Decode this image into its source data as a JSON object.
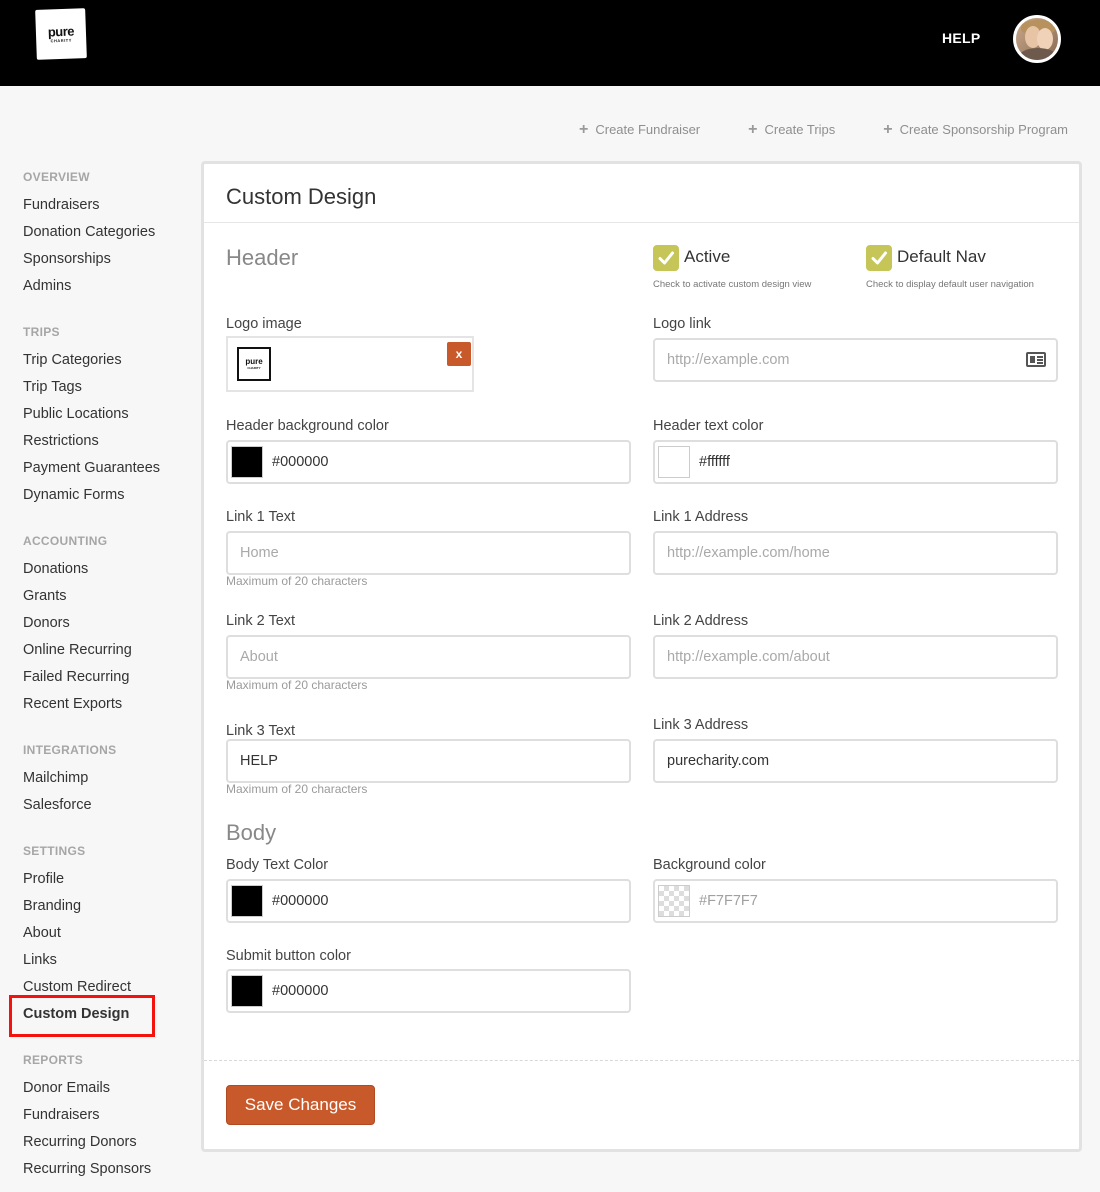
{
  "brand": {
    "logo_line1": "pure",
    "logo_line2": "CHARITY"
  },
  "topbar": {
    "help_link": "HELP"
  },
  "quick_actions": [
    {
      "icon": "plus-icon",
      "label": "Create Fundraiser"
    },
    {
      "icon": "plus-icon",
      "label": "Create Trips"
    },
    {
      "icon": "plus-icon",
      "label": "Create Sponsorship Program"
    }
  ],
  "sidebar": {
    "sections": [
      {
        "heading": "OVERVIEW",
        "items": [
          "Fundraisers",
          "Donation Categories",
          "Sponsorships",
          "Admins"
        ]
      },
      {
        "heading": "TRIPS",
        "items": [
          "Trip Categories",
          "Trip Tags",
          "Public Locations",
          "Restrictions",
          "Payment Guarantees",
          "Dynamic Forms"
        ]
      },
      {
        "heading": "ACCOUNTING",
        "items": [
          "Donations",
          "Grants",
          "Donors",
          "Online Recurring",
          "Failed Recurring",
          "Recent Exports"
        ]
      },
      {
        "heading": "INTEGRATIONS",
        "items": [
          "Mailchimp",
          "Salesforce"
        ]
      },
      {
        "heading": "SETTINGS",
        "items": [
          "Profile",
          "Branding",
          "About",
          "Links",
          "Custom Redirect",
          "Custom Design"
        ]
      },
      {
        "heading": "REPORTS",
        "items": [
          "Donor Emails",
          "Fundraisers",
          "Recurring Donors",
          "Recurring Sponsors"
        ]
      }
    ],
    "active_item": "Custom Design"
  },
  "panel": {
    "title": "Custom Design",
    "header_section": "Header",
    "body_section": "Body",
    "active_checkbox": {
      "label": "Active",
      "hint": "Check to activate custom design view",
      "checked": true
    },
    "default_nav_checkbox": {
      "label": "Default Nav",
      "hint": "Check to display default user navigation",
      "checked": true
    },
    "logo_image": {
      "label": "Logo image",
      "thumb_line1": "pure",
      "thumb_line2": "CHARITY",
      "remove": "x"
    },
    "logo_link": {
      "label": "Logo link",
      "placeholder": "http://example.com"
    },
    "header_bg_color": {
      "label": "Header background color",
      "value": "#000000"
    },
    "header_text_color": {
      "label": "Header text color",
      "value": "#ffffff"
    },
    "link1_text": {
      "label": "Link 1 Text",
      "placeholder": "Home",
      "hint": "Maximum of 20 characters"
    },
    "link1_address": {
      "label": "Link 1 Address",
      "placeholder": "http://example.com/home"
    },
    "link2_text": {
      "label": "Link 2 Text",
      "placeholder": "About",
      "hint": "Maximum of 20 characters"
    },
    "link2_address": {
      "label": "Link 2 Address",
      "placeholder": "http://example.com/about"
    },
    "link3_text": {
      "label": "Link 3 Text",
      "value": "HELP",
      "hint": "Maximum of 20 characters"
    },
    "link3_address": {
      "label": "Link 3 Address",
      "value": "purecharity.com"
    },
    "body_text_color": {
      "label": "Body Text Color",
      "value": "#000000"
    },
    "background_color": {
      "label": "Background color",
      "value": "#F7F7F7"
    },
    "submit_button_color": {
      "label": "Submit button color",
      "value": "#000000"
    },
    "save_button": "Save Changes"
  },
  "colors": {
    "accent": "#c8592a",
    "checkbox": "#c5c558",
    "highlight_box": "#f4120d",
    "topbar": "#000000"
  }
}
